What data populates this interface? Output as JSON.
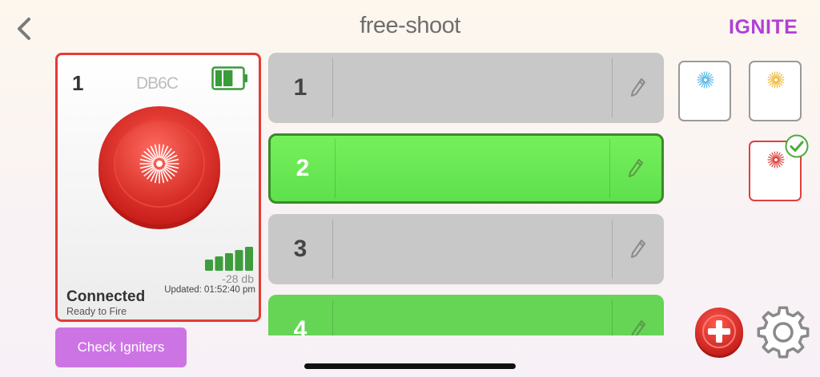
{
  "header": {
    "title": "free-shoot",
    "brand": "IGNITE"
  },
  "device": {
    "number": "1",
    "id": "DB6C",
    "battery_level": 0.67,
    "signal_bars": 5,
    "signal_db": "-28 db",
    "updated": "Updated: 01:52:40 pm",
    "status": "Connected",
    "substatus": "Ready to Fire",
    "accent_color": "#e53b36"
  },
  "actions": {
    "check_igniters": "Check Igniters"
  },
  "cues": [
    {
      "number": "1",
      "state": "empty"
    },
    {
      "number": "2",
      "state": "selected"
    },
    {
      "number": "3",
      "state": "empty"
    },
    {
      "number": "4",
      "state": "assigned"
    }
  ],
  "firework_types": [
    {
      "name": "blue-burst",
      "color": "#58b8e8",
      "selected": false
    },
    {
      "name": "yellow-burst",
      "color": "#f0b93a",
      "selected": false
    },
    {
      "name": "red-burst",
      "color": "#e0403a",
      "selected": true
    }
  ],
  "icons": {
    "back": "chevron-left-icon",
    "edit": "pencil-icon",
    "add": "plus-icon",
    "settings": "gear-icon",
    "check": "checkmark-icon"
  },
  "colors": {
    "green": "#66d455",
    "gray": "#c8c8c8",
    "purple": "#cd74e5",
    "brand": "#b13fd6"
  }
}
